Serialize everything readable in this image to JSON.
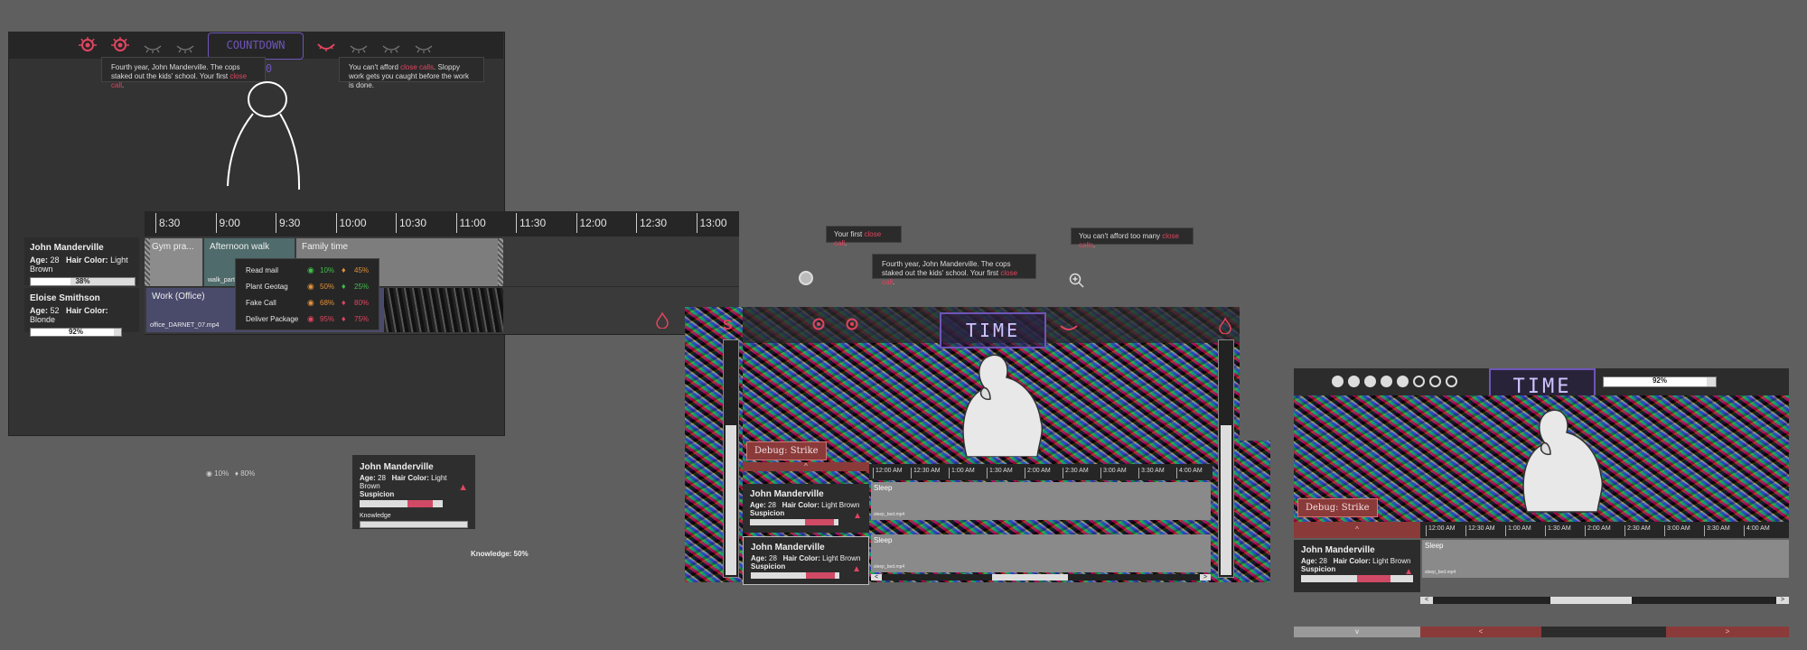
{
  "countdown_label": "COUNTDOWN 10:30",
  "tooltips": {
    "fourth_year_a": "Fourth year, John Manderville. The cops staked out the kids' school. Your first ",
    "close_call": "close call",
    "tail_dot": ".",
    "cant_afford_a": "You can't afford ",
    "sloppy": ". Sloppy work gets you caught before the work is done.",
    "first_close_call": "Your first ",
    "cant_afford_many": "You can't afford too many ",
    "close_calls": "close calls"
  },
  "timeline": {
    "ticks": [
      "8:30",
      "9:00",
      "9:30",
      "10:00",
      "10:30",
      "11:00",
      "11:30",
      "12:00",
      "12:30",
      "13:00"
    ],
    "blocks": {
      "gym": "Gym pra...",
      "walk": "Afternoon walk",
      "walk_file": "walk_part_...",
      "family": "Family time",
      "work": "Work (Office)",
      "work_file": "office_DARNET_07.mp4"
    }
  },
  "employees": [
    {
      "name": "John Manderville",
      "age_label": "Age:",
      "age": "28",
      "hair_label": "Hair Color:",
      "hair": "Light Brown",
      "progress": "38%",
      "progress_value": 0.38
    },
    {
      "name": "Eloise Smithson",
      "age_label": "Age:",
      "age": "52",
      "hair_label": "Hair Color:",
      "hair": "Blonde",
      "progress": "92%",
      "progress_value": 0.92
    }
  ],
  "actions": [
    {
      "label": "Read mail",
      "eye": "10%",
      "drop": "45%"
    },
    {
      "label": "Plant Geotag",
      "eye": "50%",
      "drop": "25%"
    },
    {
      "label": "Fake Call",
      "eye": "68%",
      "drop": "80%"
    },
    {
      "label": "Deliver Package",
      "eye": "95%",
      "drop": "75%"
    }
  ],
  "stats_inline": {
    "eye": "10%",
    "drop": "80%"
  },
  "card": {
    "name": "John Manderville",
    "age_label": "Age:",
    "age": "28",
    "hair_label": "Hair Color:",
    "hair": "Light Brown",
    "suspicion": "Suspicion",
    "knowledge": "Knowledge"
  },
  "knowledge_caption": "Knowledge: 50%",
  "game": {
    "time_label": "TIME",
    "side_letter": "S",
    "debug": "Debug: Strike",
    "ticks": [
      "12:00 AM",
      "12:30 AM",
      "1:00 AM",
      "1:30 AM",
      "2:00 AM",
      "2:30 AM",
      "3:00 AM",
      "3:30 AM",
      "4:00 AM"
    ],
    "sleep": "Sleep",
    "sleep_file": "sleep_bed.mp4",
    "percent": "92%",
    "prev": "<",
    "next": ">",
    "down": "v",
    "up": "^"
  },
  "colors": {
    "accent": "#e0455f",
    "time_purple": "#6e55b8",
    "debug_red": "#8b3a3a"
  }
}
